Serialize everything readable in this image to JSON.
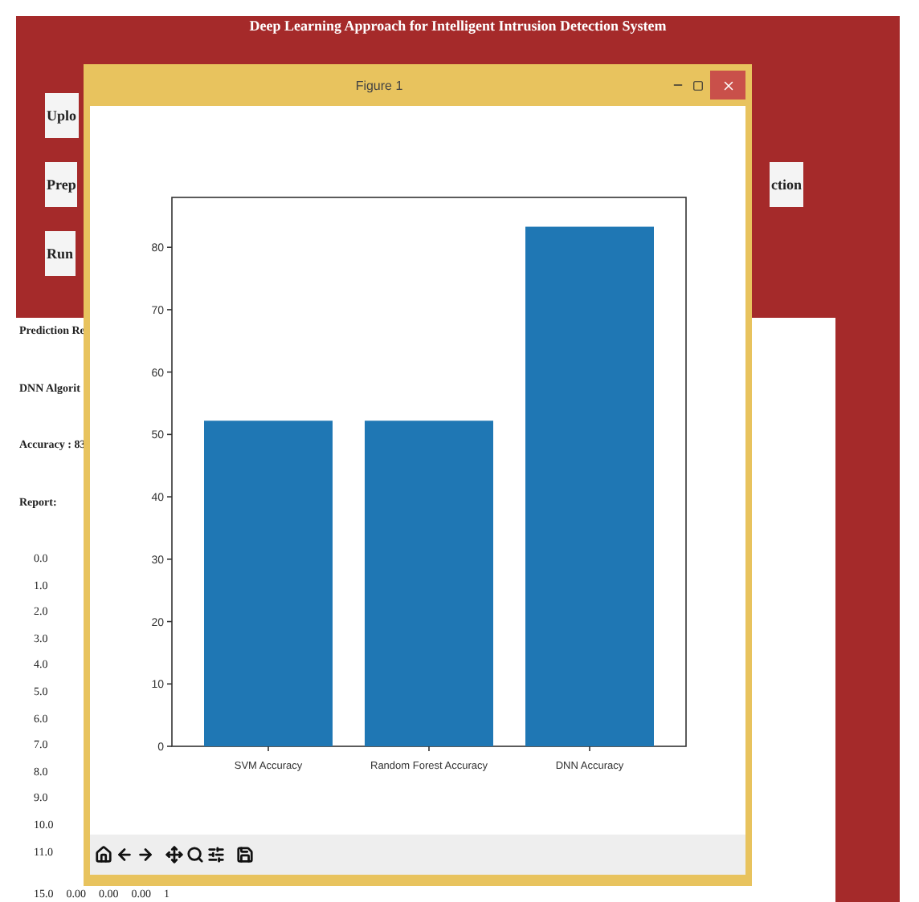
{
  "app": {
    "title": "Deep Learning Approach for Intelligent Intrusion Detection System",
    "button_rows": [
      [
        "Uplo"
      ],
      [
        "Prep",
        "ction"
      ],
      [
        "Run"
      ]
    ],
    "output": {
      "lines": [
        "Prediction Re",
        "DNN Algorit",
        "Accuracy : 83",
        "Report:"
      ],
      "report_rows": [
        [
          "0.0"
        ],
        [
          "1.0"
        ],
        [
          "2.0"
        ],
        [
          "3.0"
        ],
        [
          "4.0"
        ],
        [
          "5.0"
        ],
        [
          "6.0"
        ],
        [
          "7.0"
        ],
        [
          "8.0"
        ],
        [
          "9.0"
        ],
        [
          "10.0"
        ],
        [
          "11.0"
        ],
        [
          "15.0",
          "0.00",
          "0.00",
          "0.00",
          "1"
        ]
      ]
    }
  },
  "figure": {
    "title": "Figure 1",
    "chart_data": {
      "type": "bar",
      "categories": [
        "SVM Accuracy",
        "Random Forest Accuracy",
        "DNN Accuracy"
      ],
      "values": [
        52.2,
        52.2,
        83.3
      ],
      "ylim": [
        0,
        88
      ],
      "yticks": [
        0,
        10,
        20,
        30,
        40,
        50,
        60,
        70,
        80
      ]
    }
  }
}
